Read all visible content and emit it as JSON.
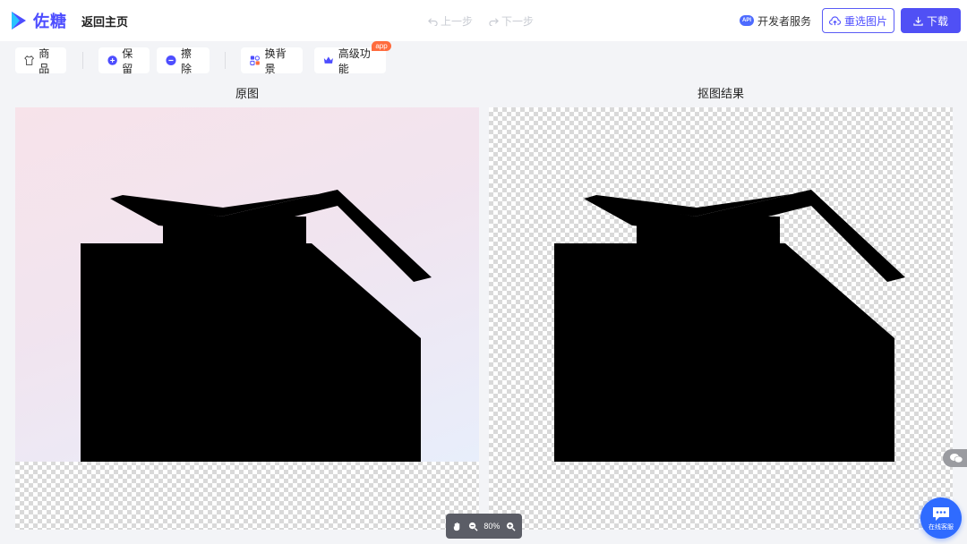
{
  "app": {
    "logo_text": "佐糖",
    "back_home_label": "返回主页"
  },
  "history": {
    "undo_label": "上一步",
    "redo_label": "下一步"
  },
  "header_actions": {
    "api_badge": "API",
    "developer_service_label": "开发者服务",
    "reselect_label": "重选图片",
    "download_label": "下载"
  },
  "toolbar": {
    "product_label": "商品",
    "keep_label": "保留",
    "erase_label": "擦除",
    "change_bg_label": "换背景",
    "advanced_label": "高级功能",
    "advanced_tag": "app"
  },
  "panels": {
    "original_title": "原图",
    "result_title": "抠图结果"
  },
  "zoom": {
    "value": "80%"
  },
  "support": {
    "online_service_label": "在线客服"
  },
  "icons": {
    "logo": "zuotang-logo-icon",
    "undo": "undo-icon",
    "redo": "redo-icon",
    "upload": "upload-cloud-icon",
    "download": "download-icon",
    "product": "shirt-icon",
    "keep": "plus-circle-icon",
    "erase": "minus-circle-icon",
    "change_bg": "background-icon",
    "advanced": "crown-icon",
    "hand": "hand-icon",
    "zoom_out": "zoom-out-icon",
    "zoom_in": "zoom-in-icon",
    "wechat": "wechat-icon",
    "chat": "chat-bubble-icon"
  },
  "colors": {
    "brand": "#4d4dff",
    "download_bg": "#5050f5",
    "app_tag": "#ff6b3d",
    "service_bubble": "#2f6bff"
  }
}
